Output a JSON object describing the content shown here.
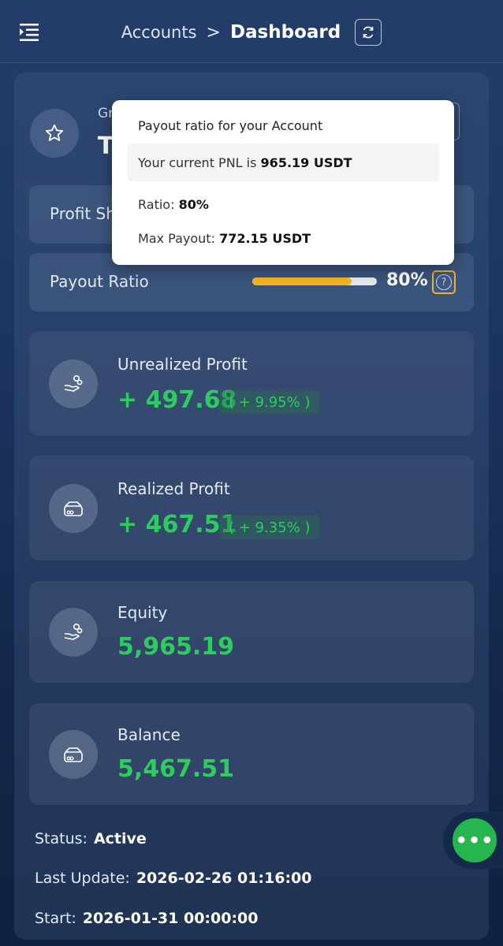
{
  "header": {
    "breadcrumb_parent": "Accounts",
    "breadcrumb_separator": ">",
    "breadcrumb_current": "Dashboard"
  },
  "account": {
    "subtitle_partial": "Gr",
    "title_partial": "T"
  },
  "profit_share": {
    "label_partial": "Profit Sh"
  },
  "payout_ratio": {
    "label": "Payout Ratio",
    "value_text": "80%",
    "progress_fraction": 0.8,
    "progress_color": "#f2b51e"
  },
  "cards": [
    {
      "label": "Unrealized Profit",
      "value": "+ 497.68",
      "pct": "( + 9.95% )",
      "icon": "hand-coins-icon"
    },
    {
      "label": "Realized Profit",
      "value": "+ 467.51",
      "pct": "( + 9.35% )",
      "icon": "wallet-icon"
    },
    {
      "label": "Equity",
      "value": "5,965.19",
      "icon": "hand-coins-icon"
    },
    {
      "label": "Balance",
      "value": "5,467.51",
      "icon": "wallet-icon"
    }
  ],
  "meta": {
    "status_label": "Status:",
    "status_value": "Active",
    "last_update_label": "Last Update:",
    "last_update_value": "2026-02-26 01:16:00",
    "start_label": "Start:",
    "start_value": "2026-01-31 00:00:00"
  },
  "popover": {
    "title": "Payout ratio for your Account",
    "pnl_prefix": "Your current PNL is",
    "pnl_value": "965.19 USDT",
    "ratio_label": "Ratio:",
    "ratio_value": "80%",
    "max_label": "Max Payout:",
    "max_value": "772.15 USDT"
  },
  "colors": {
    "positive": "#2ecc5e",
    "accent_yellow": "#f2b51e",
    "fab_green": "#27b54e"
  }
}
